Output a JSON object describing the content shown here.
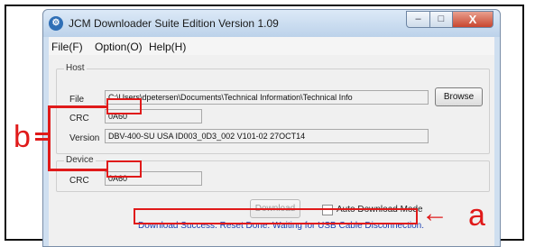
{
  "window": {
    "title": "JCM Downloader Suite Edition Version 1.09",
    "app_icon_glyph": "⚙",
    "minimize_glyph": "‒",
    "maximize_glyph": "□",
    "close_glyph": "X"
  },
  "menu": [
    "File(F)",
    "Option(O)",
    "Help(H)"
  ],
  "host": {
    "group_label": "Host",
    "file_label": "File",
    "file_value": "C:\\Users\\dpetersen\\Documents\\Technical Information\\Technical Info",
    "browse_label": "Browse",
    "crc_label": "CRC",
    "crc_value": "0A60",
    "version_label": "Version",
    "version_value": "DBV-400-SU USA ID003_0D3_002 V101-02 27OCT14"
  },
  "device": {
    "group_label": "Device",
    "crc_label": "CRC",
    "crc_value": "0A60"
  },
  "download_label": "Download",
  "auto_download_label": "Auto Download Mode",
  "status_text": "Download Success. Reset Done. Waiting for USB Cable Disconnection.",
  "annotations": {
    "a": "a",
    "b": "b",
    "arrow": "←"
  },
  "colors": {
    "highlight": "#e01a1a",
    "status_text": "#1a3fb0"
  }
}
